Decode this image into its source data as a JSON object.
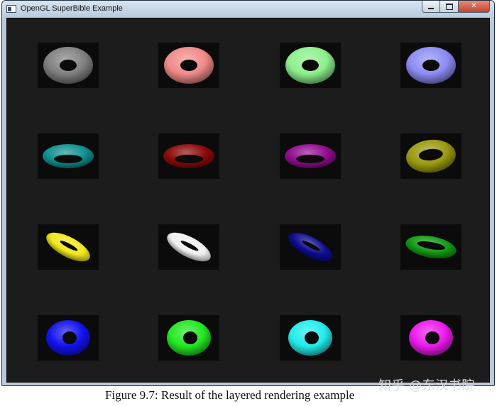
{
  "window": {
    "title": "OpenGL SuperBible Example",
    "controls": {
      "minimize_icon": "minimize-icon",
      "maximize_icon": "maximize-icon",
      "close_label": "✕"
    }
  },
  "tiles": [
    {
      "name": "torus-gray",
      "color": "#808080",
      "view": "front"
    },
    {
      "name": "torus-salmon",
      "color": "#f08a88",
      "view": "front"
    },
    {
      "name": "torus-light-green",
      "color": "#8cf08c",
      "view": "front"
    },
    {
      "name": "torus-light-blue",
      "color": "#8c8cf5",
      "view": "front"
    },
    {
      "name": "torus-teal",
      "color": "#109090",
      "view": "tilt-low"
    },
    {
      "name": "torus-dark-red",
      "color": "#8c0a0a",
      "view": "tilt-low"
    },
    {
      "name": "torus-purple",
      "color": "#900c90",
      "view": "tilt-low"
    },
    {
      "name": "torus-olive",
      "color": "#9a9a10",
      "view": "tilt-high"
    },
    {
      "name": "torus-yellow",
      "color": "#f0e81a",
      "view": "edge-right"
    },
    {
      "name": "torus-white",
      "color": "#f0f0f0",
      "view": "edge-right"
    },
    {
      "name": "torus-navy",
      "color": "#0c0c90",
      "view": "edge-right"
    },
    {
      "name": "torus-green",
      "color": "#129a12",
      "view": "edge-right-open"
    },
    {
      "name": "torus-blue",
      "color": "#1212f0",
      "view": "front-small"
    },
    {
      "name": "torus-bright-green",
      "color": "#22e822",
      "view": "front-small"
    },
    {
      "name": "torus-cyan",
      "color": "#22ecec",
      "view": "front-small"
    },
    {
      "name": "torus-magenta",
      "color": "#ec1aec",
      "view": "front-small"
    }
  ],
  "caption": "Figure 9.7: Result of the layered rendering example",
  "watermark": "知乎 @东汉书院"
}
